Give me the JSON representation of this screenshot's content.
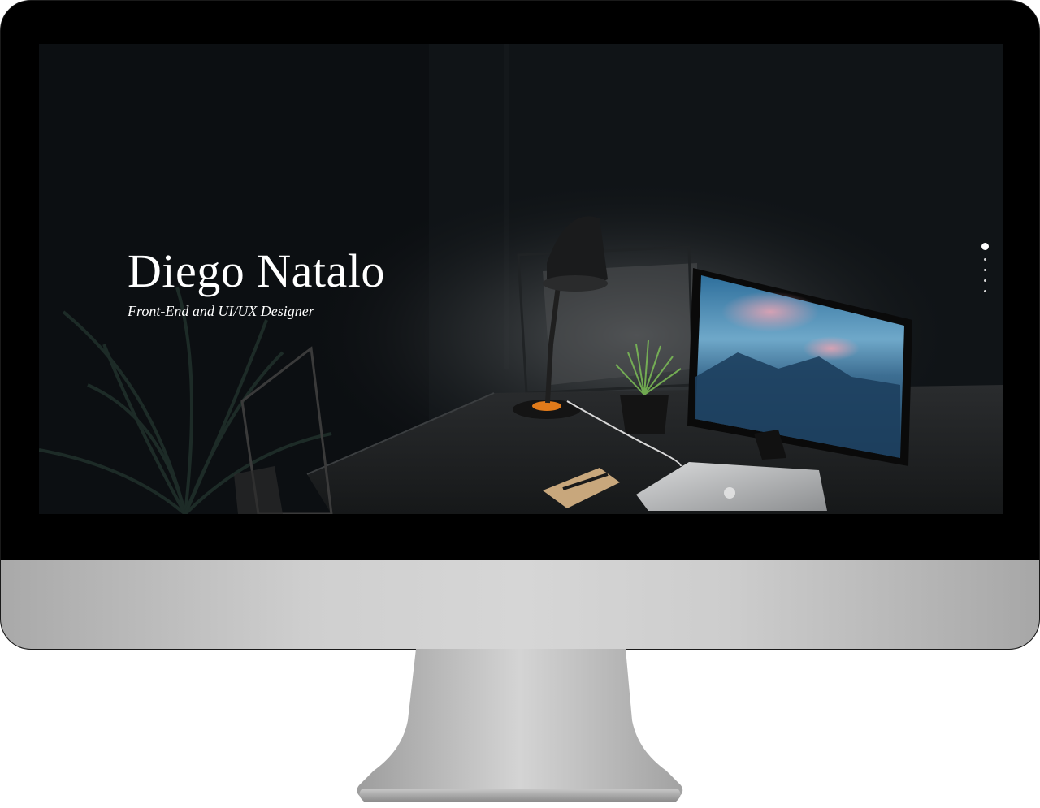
{
  "hero": {
    "name": "Diego Natalo",
    "role": "Front-End and UI/UX Designer"
  },
  "slider": {
    "slide_count": 5,
    "active_index": 0
  },
  "colors": {
    "background": "#0c0f12",
    "text": "#ffffff",
    "bezel": "#000000",
    "aluminum": "#cfcfcf"
  },
  "icons": {
    "apple_laptop_logo": "apple-logo-icon"
  }
}
